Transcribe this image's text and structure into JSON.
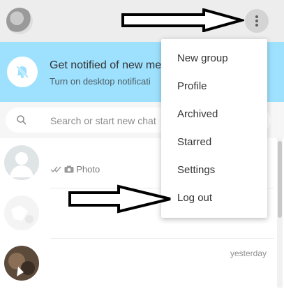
{
  "menu": {
    "items": [
      {
        "label": "New group"
      },
      {
        "label": "Profile"
      },
      {
        "label": "Archived"
      },
      {
        "label": "Starred"
      },
      {
        "label": "Settings"
      },
      {
        "label": "Log out"
      }
    ]
  },
  "notification": {
    "title": "Get notified of new me",
    "subtitle": "Turn on desktop notificati"
  },
  "search": {
    "placeholder": "Search or start new chat"
  },
  "chats": [
    {
      "name": "",
      "preview": "Photo",
      "time": ""
    },
    {
      "name": "",
      "preview": "",
      "time": ""
    },
    {
      "name": "",
      "preview": "",
      "time": "yesterday"
    }
  ],
  "colors": {
    "header_bg": "#ededed",
    "banner_bg": "#9de1fe",
    "status_dot": "#1ebea5",
    "arrow": "#000000"
  },
  "icons": {
    "header": [
      "status-icon",
      "new-chat-icon",
      "menu-icon"
    ],
    "banner": "bell-off-icon",
    "search": "search-icon",
    "preview": [
      "double-check-icon",
      "camera-icon"
    ]
  }
}
